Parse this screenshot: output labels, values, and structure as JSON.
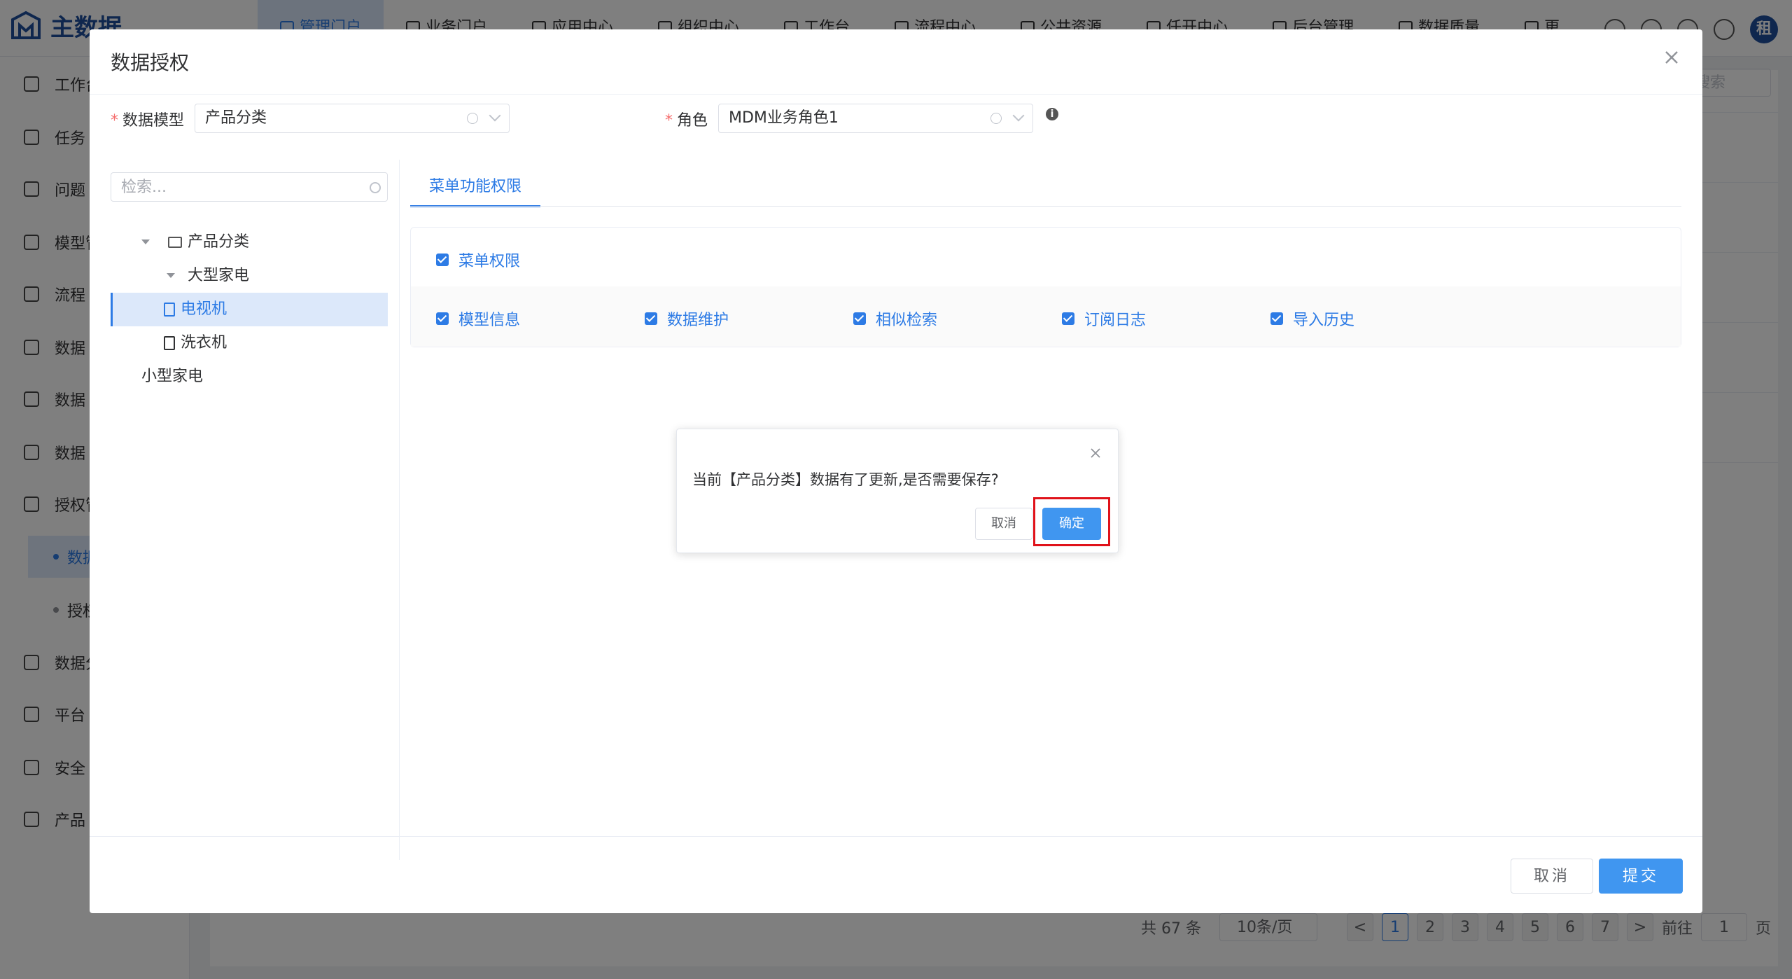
{
  "app": {
    "name": "主数据"
  },
  "nav": [
    "管理门户",
    "业务门户",
    "应用中心",
    "组织中心",
    "工作台",
    "流程中心",
    "公共资源",
    "任开中心",
    "后台管理",
    "数据质量",
    "更"
  ],
  "sidebar": {
    "items": [
      "工作台",
      "任务",
      "问题",
      "模型管",
      "流程",
      "数据",
      "数据",
      "数据",
      "授权管",
      "数据分",
      "平台",
      "安全",
      "产品"
    ],
    "sub_active": "数据",
    "sub_other": "授权"
  },
  "background": {
    "search_placeholder": "搜索",
    "pagination": {
      "total": "共 67 条",
      "page_size": "10条/页",
      "pages": [
        "1",
        "2",
        "3",
        "4",
        "5",
        "6",
        "7"
      ],
      "prev": "<",
      "next": ">",
      "goto_label": "前往",
      "goto_value": "1",
      "page_unit": "页"
    }
  },
  "dialog": {
    "title": "数据授权",
    "model_label": "数据模型",
    "model_value": "产品分类",
    "role_label": "角色",
    "role_value": "MDM业务角色1",
    "info_icon": "i",
    "search_placeholder": "检索...",
    "tree": {
      "root": "产品分类",
      "large": "大型家电",
      "tv": "电视机",
      "washer": "洗衣机",
      "small": "小型家电"
    },
    "tab": "菜单功能权限",
    "menu_perm_label": "菜单权限",
    "perms": [
      "模型信息",
      "数据维护",
      "相似检索",
      "订阅日志",
      "导入历史"
    ],
    "cancel_label": "取消",
    "submit_label": "提交"
  },
  "confirm": {
    "message": "当前【产品分类】数据有了更新,是否需要保存?",
    "cancel_label": "取消",
    "ok_label": "确定"
  },
  "colors": {
    "primary": "#4096f0",
    "highlight": "#e0121a",
    "required": "#f56c6c"
  }
}
